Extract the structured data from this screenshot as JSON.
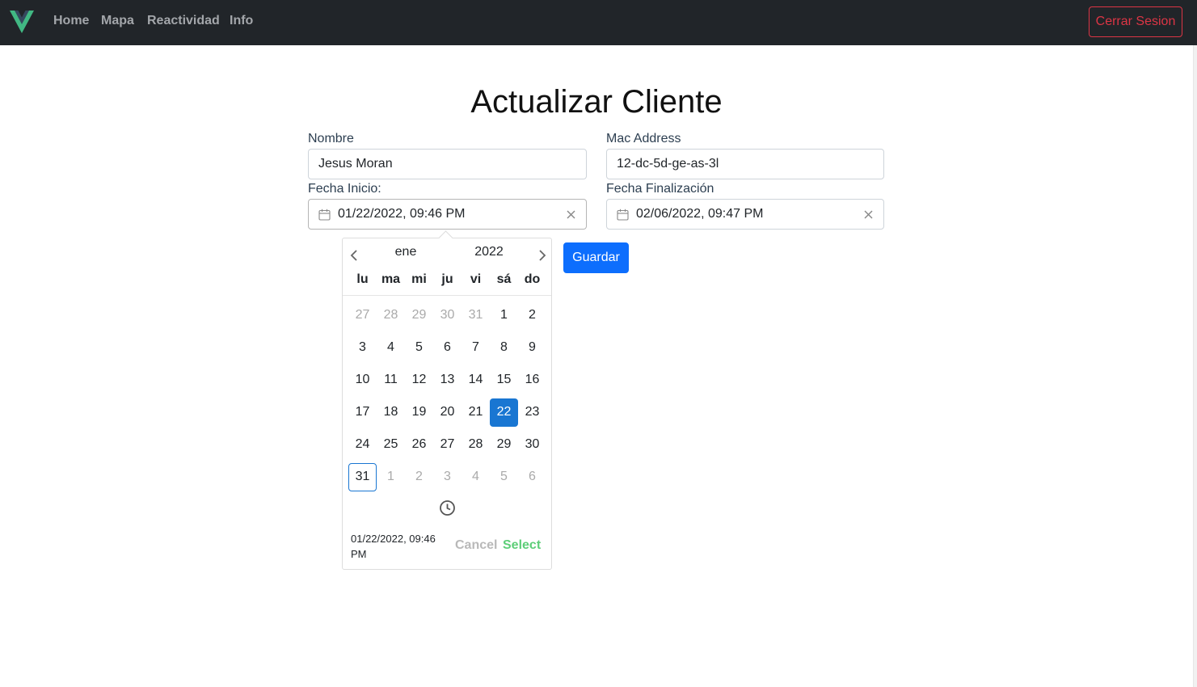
{
  "navbar": {
    "logo_color_outer": "#41b883",
    "logo_color_inner": "#35495e",
    "links": [
      "Home",
      "Mapa",
      "Reactividad",
      "Info"
    ],
    "logout_label": "Cerrar Sesion"
  },
  "page": {
    "title": "Actualizar Cliente"
  },
  "form": {
    "nombre_label": "Nombre",
    "nombre_value": "Jesus Moran",
    "mac_label": "Mac Address",
    "mac_value": "12-dc-5d-ge-as-3l",
    "fecha_inicio_label": "Fecha Inicio:",
    "fecha_inicio_value": "01/22/2022, 09:46 PM",
    "fecha_fin_label": "Fecha Finalización",
    "fecha_fin_value": "02/06/2022, 09:47 PM",
    "save_label": "Guardar"
  },
  "datepicker": {
    "month": "ene",
    "year": "2022",
    "weekdays": [
      "lu",
      "ma",
      "mi",
      "ju",
      "vi",
      "sá",
      "do"
    ],
    "weeks": [
      [
        {
          "d": "27",
          "m": true
        },
        {
          "d": "28",
          "m": true
        },
        {
          "d": "29",
          "m": true
        },
        {
          "d": "30",
          "m": true
        },
        {
          "d": "31",
          "m": true
        },
        {
          "d": "1"
        },
        {
          "d": "2"
        }
      ],
      [
        {
          "d": "3"
        },
        {
          "d": "4"
        },
        {
          "d": "5"
        },
        {
          "d": "6"
        },
        {
          "d": "7"
        },
        {
          "d": "8"
        },
        {
          "d": "9"
        }
      ],
      [
        {
          "d": "10"
        },
        {
          "d": "11"
        },
        {
          "d": "12"
        },
        {
          "d": "13"
        },
        {
          "d": "14"
        },
        {
          "d": "15"
        },
        {
          "d": "16"
        }
      ],
      [
        {
          "d": "17"
        },
        {
          "d": "18"
        },
        {
          "d": "19"
        },
        {
          "d": "20"
        },
        {
          "d": "21"
        },
        {
          "d": "22",
          "sel": true
        },
        {
          "d": "23"
        }
      ],
      [
        {
          "d": "24"
        },
        {
          "d": "25"
        },
        {
          "d": "26"
        },
        {
          "d": "27"
        },
        {
          "d": "28"
        },
        {
          "d": "29"
        },
        {
          "d": "30"
        }
      ],
      [
        {
          "d": "31",
          "today": true
        },
        {
          "d": "1",
          "m": true
        },
        {
          "d": "2",
          "m": true
        },
        {
          "d": "3",
          "m": true
        },
        {
          "d": "4",
          "m": true
        },
        {
          "d": "5",
          "m": true
        },
        {
          "d": "6",
          "m": true
        }
      ]
    ],
    "preview": "01/22/2022, 09:46 PM",
    "cancel_label": "Cancel",
    "select_label": "Select"
  }
}
